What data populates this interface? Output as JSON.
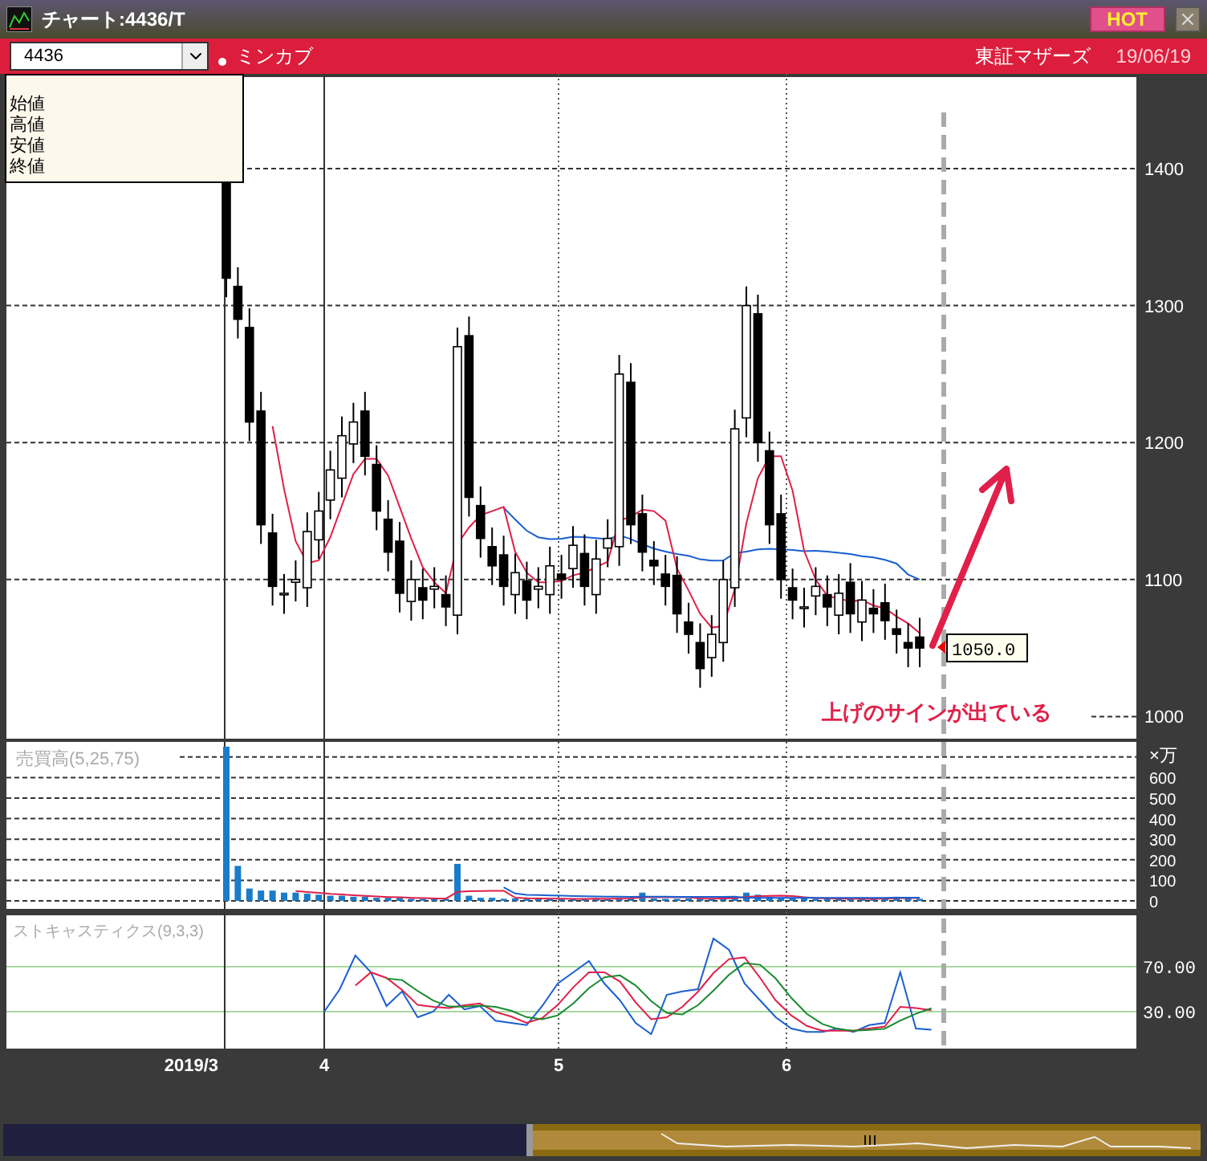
{
  "window": {
    "title": "チャート:4436/T",
    "hot_button": "HOT"
  },
  "toolbar": {
    "symbol": "4436",
    "source": "ミンカブ",
    "market": "東証マザーズ",
    "date": "19/06/19"
  },
  "legend": {
    "items": [
      "始値",
      "高値",
      "安値",
      "終値"
    ]
  },
  "price_panel": {
    "y_ticks": [
      "1400",
      "1300",
      "1200",
      "1100",
      "1000"
    ],
    "price_tag": "1050.0",
    "annotation": "上げのサインが出ている"
  },
  "volume_panel": {
    "title": "売買高(5,25,75)",
    "unit": "×万",
    "y_ticks": [
      "600",
      "500",
      "400",
      "300",
      "200",
      "100",
      "0"
    ]
  },
  "stochastic_panel": {
    "title": "ストキャスティクス(9,3,3)",
    "y_ticks": [
      "70.00",
      "30.00"
    ]
  },
  "x_axis": {
    "labels": [
      "2019/3",
      "4",
      "5",
      "6"
    ]
  }
}
